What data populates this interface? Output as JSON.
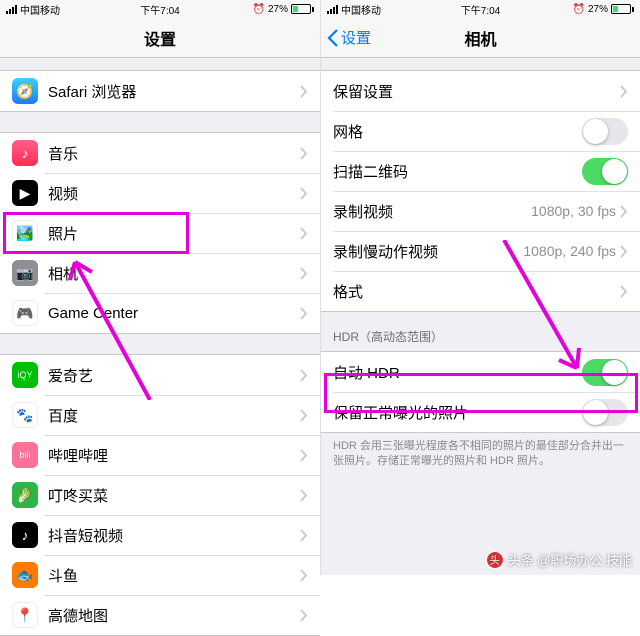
{
  "status": {
    "carrier": "中国移动",
    "time": "下午7:04",
    "battery_pct": "27%"
  },
  "left": {
    "title": "设置",
    "group1": [
      {
        "label": "Safari 浏览器"
      }
    ],
    "group2": [
      {
        "label": "音乐"
      },
      {
        "label": "视频"
      },
      {
        "label": "照片"
      },
      {
        "label": "相机"
      },
      {
        "label": "Game Center"
      }
    ],
    "group3": [
      {
        "label": "爱奇艺"
      },
      {
        "label": "百度"
      },
      {
        "label": "哔哩哔哩"
      },
      {
        "label": "叮咚买菜"
      },
      {
        "label": "抖音短视频"
      },
      {
        "label": "斗鱼"
      },
      {
        "label": "高德地图"
      }
    ]
  },
  "right": {
    "back": "设置",
    "title": "相机",
    "group1": [
      {
        "label": "保留设置",
        "type": "chev"
      },
      {
        "label": "网格",
        "type": "toggle",
        "on": false
      },
      {
        "label": "扫描二维码",
        "type": "toggle",
        "on": true
      },
      {
        "label": "录制视频",
        "type": "value",
        "value": "1080p, 30 fps"
      },
      {
        "label": "录制慢动作视频",
        "type": "value",
        "value": "1080p, 240 fps"
      },
      {
        "label": "格式",
        "type": "chev"
      }
    ],
    "hdr_header": "HDR（高动态范围）",
    "group2": [
      {
        "label": "自动 HDR",
        "type": "toggle",
        "on": true
      },
      {
        "label": "保留正常曝光的照片",
        "type": "toggle",
        "on": false
      }
    ],
    "hdr_footer": "HDR 会用三张曝光程度各不相同的照片的最佳部分合并出一张照片。存储正常曝光的照片和 HDR 照片。"
  },
  "watermark": "头条 @职场办公.技能"
}
